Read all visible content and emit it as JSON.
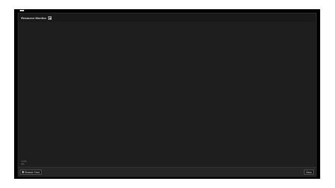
{
  "window": {
    "title": "Resource Monitor",
    "title_icon": "monitor-icon"
  },
  "content": {
    "meta_line_1": "Limits",
    "meta_line_2": "0%"
  },
  "footer": {
    "restore_label": "Restore Feed",
    "restore_icon": "refresh-icon",
    "clear_label": "Clear"
  }
}
